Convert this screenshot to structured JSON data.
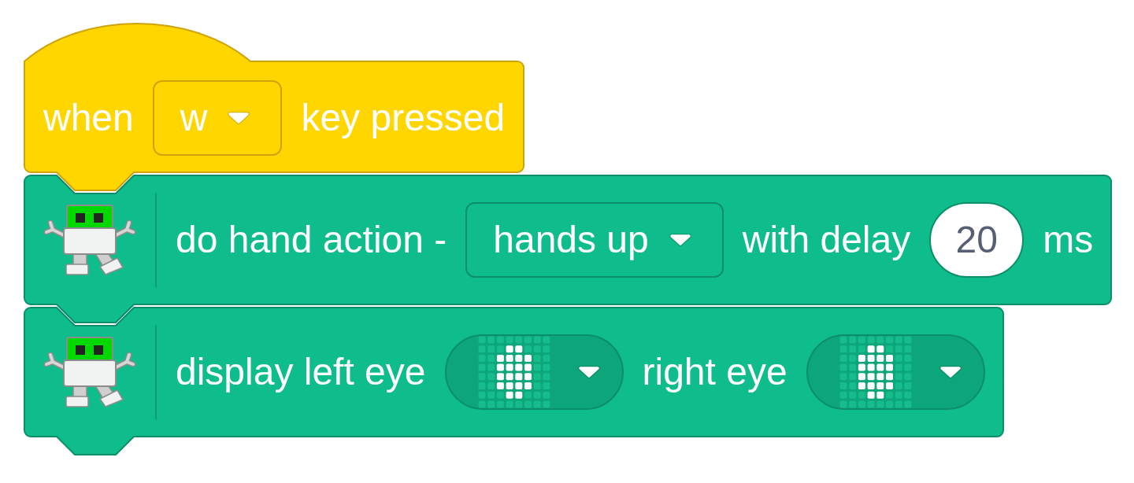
{
  "blocks": [
    {
      "kind": "hat",
      "parts": [
        {
          "kind": "label",
          "text": "when"
        },
        {
          "kind": "dropdown",
          "value": "w"
        },
        {
          "kind": "label",
          "text": "key pressed"
        }
      ]
    },
    {
      "kind": "command",
      "parts": [
        {
          "kind": "label",
          "text": "do hand action -"
        },
        {
          "kind": "dropdown",
          "value": "hands up"
        },
        {
          "kind": "label",
          "text": "with delay"
        },
        {
          "kind": "number",
          "value": "20"
        },
        {
          "kind": "label",
          "text": "ms"
        }
      ]
    },
    {
      "kind": "command",
      "parts": [
        {
          "kind": "label",
          "text": "display left eye"
        },
        {
          "kind": "matrix",
          "lit": [
            [
              false,
              false,
              false,
              false,
              false,
              false,
              false,
              false
            ],
            [
              false,
              false,
              false,
              true,
              true,
              false,
              false,
              false
            ],
            [
              false,
              false,
              true,
              true,
              true,
              true,
              false,
              false
            ],
            [
              false,
              false,
              true,
              true,
              true,
              true,
              false,
              false
            ],
            [
              false,
              false,
              true,
              true,
              true,
              true,
              false,
              false
            ],
            [
              false,
              false,
              true,
              true,
              true,
              true,
              false,
              false
            ],
            [
              false,
              false,
              false,
              true,
              true,
              false,
              false,
              false
            ],
            [
              false,
              false,
              false,
              false,
              false,
              false,
              false,
              false
            ]
          ]
        },
        {
          "kind": "label",
          "text": "right eye"
        },
        {
          "kind": "matrix",
          "lit": [
            [
              false,
              false,
              false,
              false,
              false,
              false,
              false,
              false
            ],
            [
              false,
              false,
              false,
              true,
              true,
              false,
              false,
              false
            ],
            [
              false,
              false,
              true,
              true,
              true,
              true,
              false,
              false
            ],
            [
              false,
              false,
              true,
              true,
              true,
              true,
              false,
              false
            ],
            [
              false,
              false,
              true,
              true,
              true,
              true,
              false,
              false
            ],
            [
              false,
              false,
              true,
              true,
              true,
              true,
              false,
              false
            ],
            [
              false,
              false,
              false,
              true,
              true,
              false,
              false,
              false
            ],
            [
              false,
              false,
              false,
              false,
              false,
              false,
              false,
              false
            ]
          ]
        }
      ]
    }
  ]
}
